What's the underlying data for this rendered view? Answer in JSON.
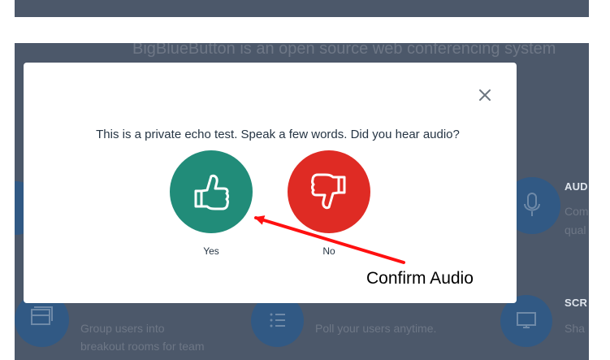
{
  "background": {
    "tagline": "BigBlueButton is an open source web conferencing system",
    "feature_audio_title": "AUD",
    "feature_audio_desc_line1": "Com",
    "feature_audio_desc_line2": "qual",
    "feature_screen_title": "SCR",
    "feature_screen_desc": "Sha",
    "feature_breakout_desc_line1": "Group users into",
    "feature_breakout_desc_line2": "breakout rooms for team",
    "feature_polling_desc": "Poll your users anytime.",
    "colors": {
      "panel": "#4c586a",
      "circle": "#2f5a86"
    }
  },
  "modal": {
    "prompt": "This is a private echo test. Speak a few words. Did you hear audio?",
    "yes_label": "Yes",
    "no_label": "No",
    "close_icon": "close-icon",
    "yes_icon": "thumbs-up-icon",
    "no_icon": "thumbs-down-icon",
    "colors": {
      "yes": "#218c79",
      "no": "#df2b24"
    }
  },
  "annotation": {
    "text": "Confirm Audio",
    "arrow_color": "#ff1010"
  }
}
